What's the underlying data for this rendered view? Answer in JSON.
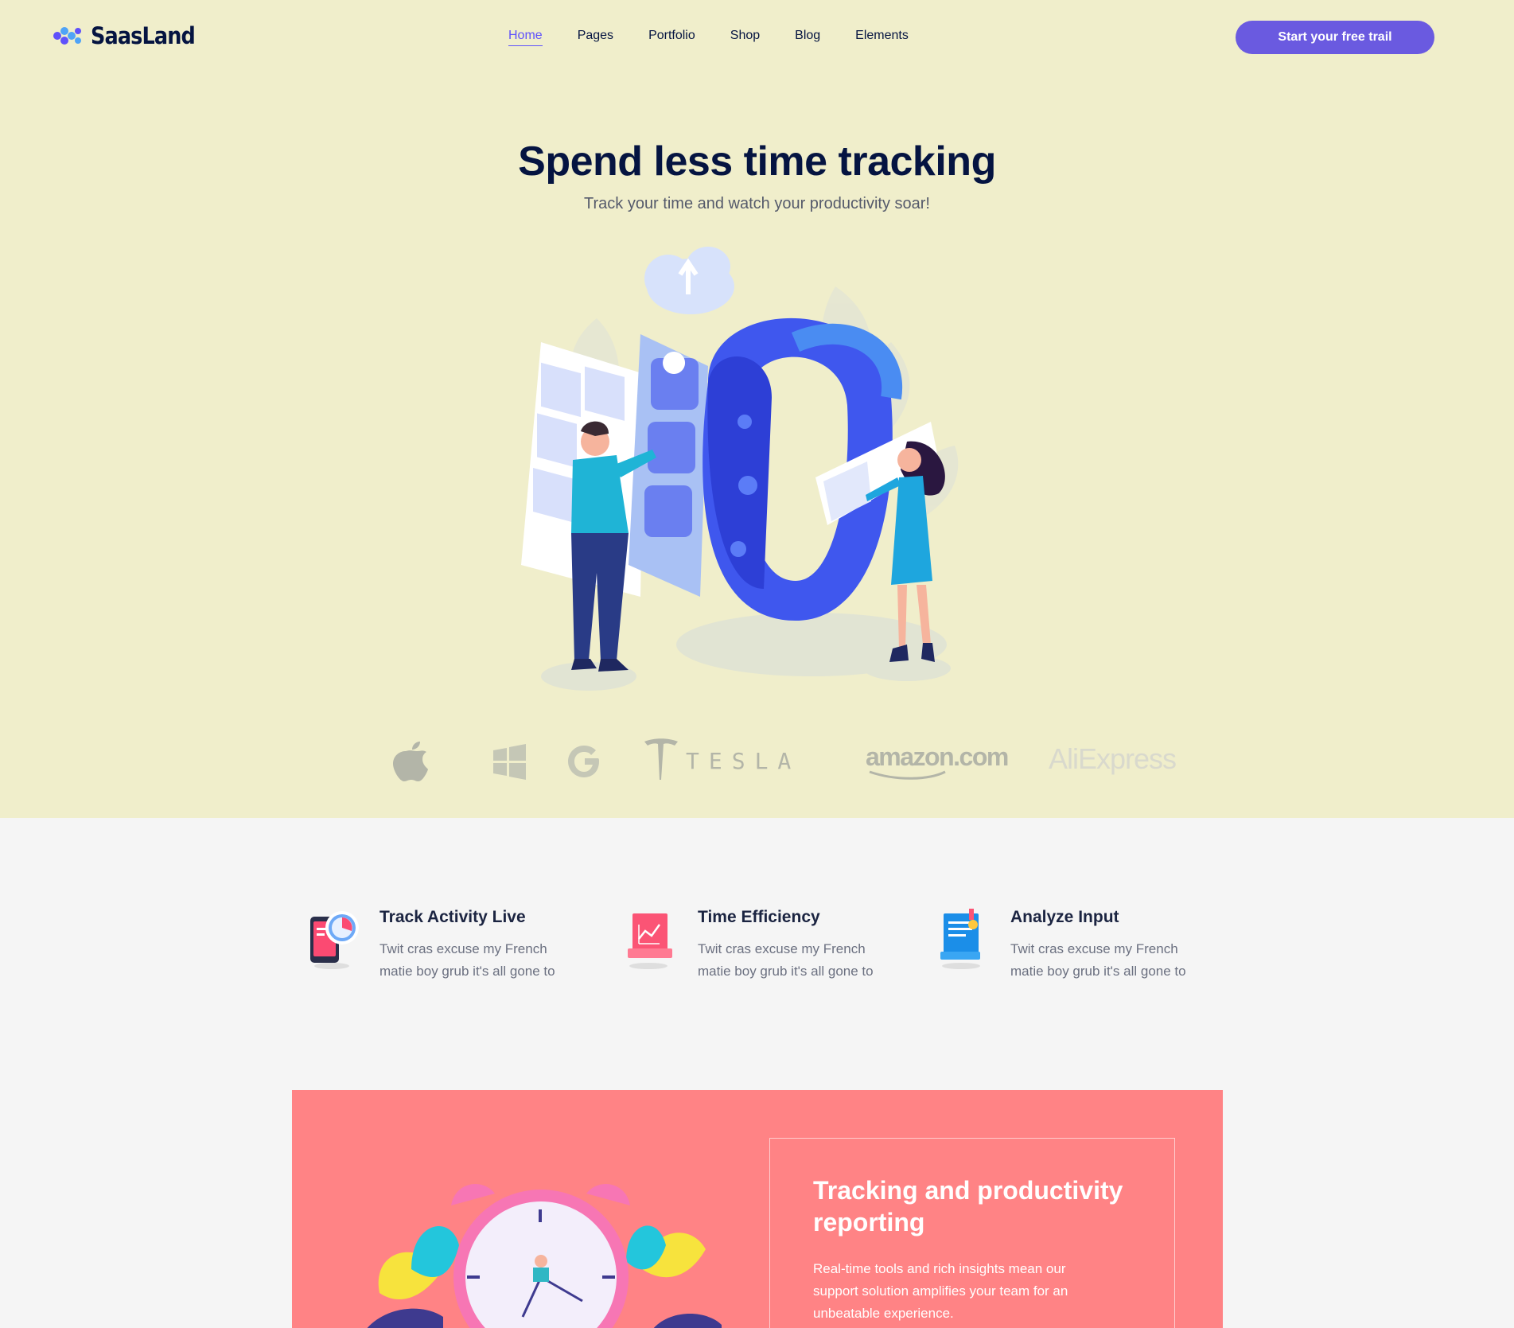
{
  "header": {
    "logo_text": "SaasLand",
    "nav": [
      {
        "label": "Home",
        "active": true
      },
      {
        "label": "Pages"
      },
      {
        "label": "Portfolio"
      },
      {
        "label": "Shop"
      },
      {
        "label": "Blog"
      },
      {
        "label": "Elements"
      }
    ],
    "cta_label": "Start your free trail"
  },
  "hero": {
    "title_regular": "Spend less ",
    "title_bold": "time tracking",
    "subtitle": "Track your time and watch your productivity soar!"
  },
  "brands": {
    "items": [
      "apple-logo",
      "windows-logo",
      "google-logo",
      "tesla-logo",
      "amazon-logo",
      "aliexpress-logo"
    ],
    "tesla_text": "TESLA",
    "amazon_text": "amazon.com",
    "aliexpress_text": "AliExpress"
  },
  "features": [
    {
      "title": "Track Activity Live",
      "desc": "Twit cras excuse my French matie boy grub it's all gone to",
      "icon": "phone-clock-icon"
    },
    {
      "title": "Time Efficiency",
      "desc": "Twit cras excuse my French matie boy grub it's all gone to",
      "icon": "chart-board-icon"
    },
    {
      "title": "Analyze Input",
      "desc": "Twit cras excuse my French matie boy grub it's all gone to",
      "icon": "document-icon"
    }
  ],
  "promo": {
    "title": "Tracking and productivity reporting",
    "text": "Real-time tools and rich insights mean our support solution amplifies your team for an unbeatable experience."
  },
  "colors": {
    "hero_bg": "#f0eecb",
    "accent": "#6a5ae0",
    "promo_bg": "#ff8385",
    "navy": "#051441"
  }
}
